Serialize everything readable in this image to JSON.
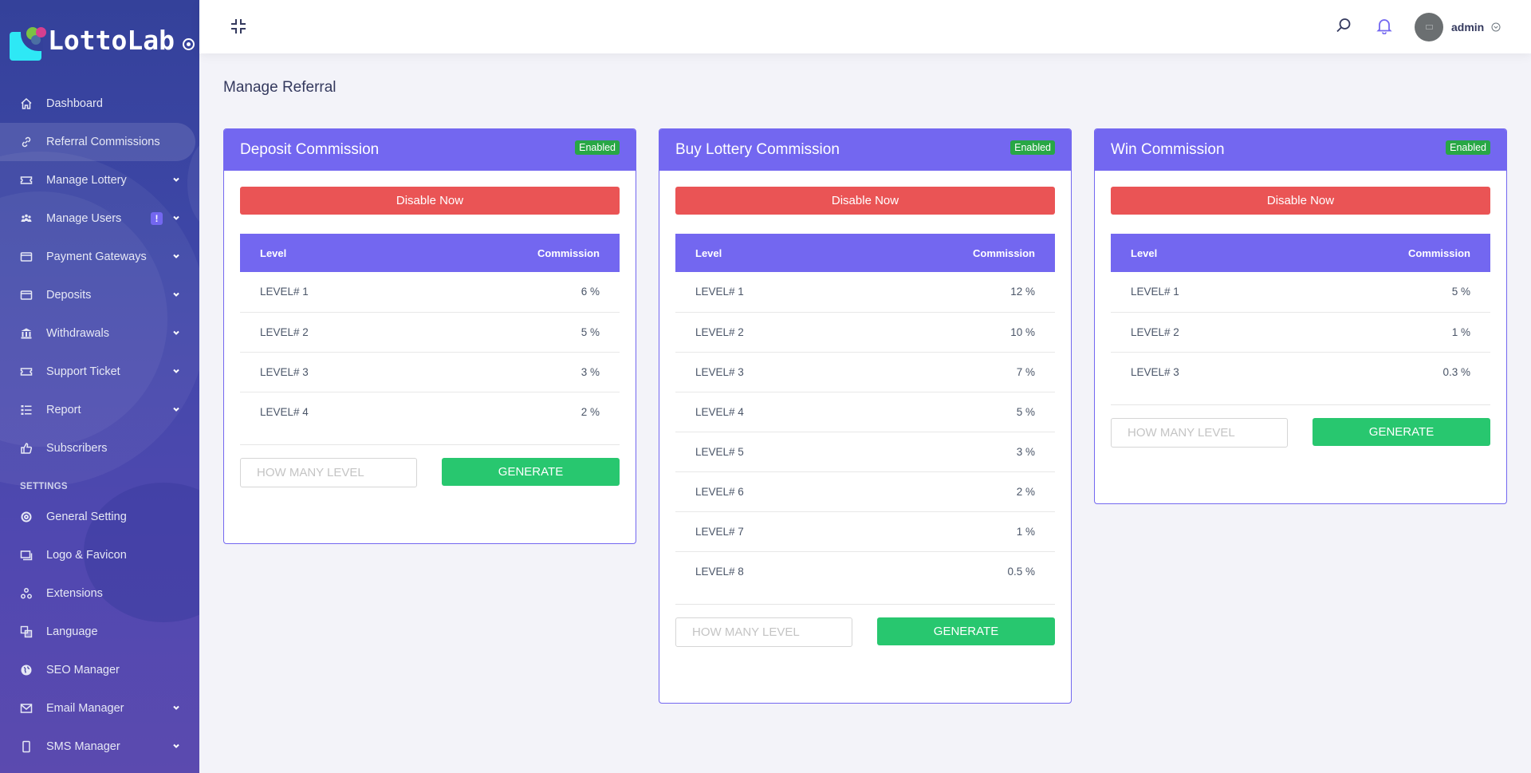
{
  "brand": {
    "name": "LottoLab"
  },
  "sidebar": {
    "items": [
      {
        "label": "Dashboard",
        "icon": "home-icon",
        "active": false,
        "has_submenu": false
      },
      {
        "label": "Referral Commissions",
        "icon": "link-icon",
        "active": true,
        "has_submenu": false
      },
      {
        "label": "Manage Lottery",
        "icon": "ticket-icon",
        "active": false,
        "has_submenu": true
      },
      {
        "label": "Manage Users",
        "icon": "users-icon",
        "active": false,
        "has_submenu": true,
        "badge": "!"
      },
      {
        "label": "Payment Gateways",
        "icon": "credit-card-icon",
        "active": false,
        "has_submenu": true
      },
      {
        "label": "Deposits",
        "icon": "credit-card-icon",
        "active": false,
        "has_submenu": true
      },
      {
        "label": "Withdrawals",
        "icon": "bank-icon",
        "active": false,
        "has_submenu": true
      },
      {
        "label": "Support Ticket",
        "icon": "ticket-icon",
        "active": false,
        "has_submenu": true
      },
      {
        "label": "Report",
        "icon": "list-icon",
        "active": false,
        "has_submenu": true
      },
      {
        "label": "Subscribers",
        "icon": "thumbs-up-icon",
        "active": false,
        "has_submenu": false
      }
    ],
    "settings_heading": "SETTINGS",
    "settings_items": [
      {
        "label": "General Setting",
        "icon": "lifebuoy-icon",
        "has_submenu": false
      },
      {
        "label": "Logo & Favicon",
        "icon": "images-icon",
        "has_submenu": false
      },
      {
        "label": "Extensions",
        "icon": "cubes-icon",
        "has_submenu": false
      },
      {
        "label": "Language",
        "icon": "language-icon",
        "has_submenu": false
      },
      {
        "label": "SEO Manager",
        "icon": "globe-icon",
        "has_submenu": false
      },
      {
        "label": "Email Manager",
        "icon": "envelope-icon",
        "has_submenu": true
      },
      {
        "label": "SMS Manager",
        "icon": "mobile-icon",
        "has_submenu": true
      }
    ]
  },
  "topbar": {
    "user_name": "admin"
  },
  "page": {
    "title": "Manage Referral"
  },
  "colors": {
    "primary": "#7367f0",
    "danger": "#ea5455",
    "success": "#28c76f",
    "badge_success": "#28a745"
  },
  "cards": [
    {
      "title": "Deposit Commission",
      "status": "Enabled",
      "disable_label": "Disable Now",
      "col_level": "Level",
      "col_commission": "Commission",
      "rows": [
        {
          "level": "LEVEL# 1",
          "commission": "6 %"
        },
        {
          "level": "LEVEL# 2",
          "commission": "5 %"
        },
        {
          "level": "LEVEL# 3",
          "commission": "3 %"
        },
        {
          "level": "LEVEL# 4",
          "commission": "2 %"
        }
      ],
      "input_placeholder": "HOW MANY LEVEL",
      "input_value": "",
      "generate_label": "GENERATE"
    },
    {
      "title": "Buy Lottery Commission",
      "status": "Enabled",
      "disable_label": "Disable Now",
      "col_level": "Level",
      "col_commission": "Commission",
      "rows": [
        {
          "level": "LEVEL# 1",
          "commission": "12 %"
        },
        {
          "level": "LEVEL# 2",
          "commission": "10 %"
        },
        {
          "level": "LEVEL# 3",
          "commission": "7 %"
        },
        {
          "level": "LEVEL# 4",
          "commission": "5 %"
        },
        {
          "level": "LEVEL# 5",
          "commission": "3 %"
        },
        {
          "level": "LEVEL# 6",
          "commission": "2 %"
        },
        {
          "level": "LEVEL# 7",
          "commission": "1 %"
        },
        {
          "level": "LEVEL# 8",
          "commission": "0.5 %"
        }
      ],
      "input_placeholder": "HOW MANY LEVEL",
      "input_value": "",
      "generate_label": "GENERATE"
    },
    {
      "title": "Win Commission",
      "status": "Enabled",
      "disable_label": "Disable Now",
      "col_level": "Level",
      "col_commission": "Commission",
      "rows": [
        {
          "level": "LEVEL# 1",
          "commission": "5 %"
        },
        {
          "level": "LEVEL# 2",
          "commission": "1 %"
        },
        {
          "level": "LEVEL# 3",
          "commission": "0.3 %"
        }
      ],
      "input_placeholder": "HOW MANY LEVEL",
      "input_value": "",
      "generate_label": "GENERATE"
    }
  ]
}
